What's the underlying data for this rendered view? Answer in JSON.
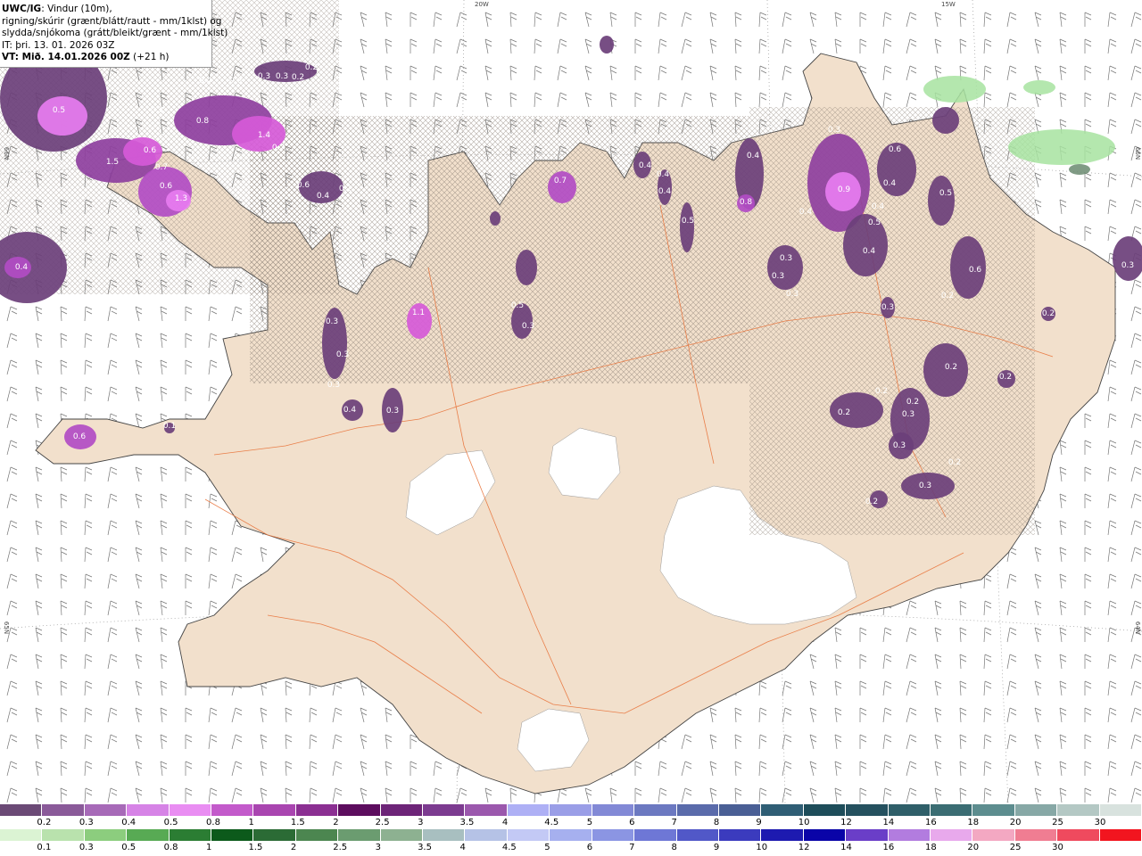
{
  "header": {
    "title_model": "UWC/IG",
    "title_rest": ": Vindur (10m),",
    "line2": "rigning/skúrir (grænt/blátt/rautt - mm/1klst) og",
    "line3": "slydda/snjókoma (grátt/bleikt/grænt - mm/1klst)",
    "init_time": "IT: þri. 13. 01. 2026 03Z",
    "valid_time_bold": "VT: Mið. 14.01.2026 00Z",
    "valid_time_rest": " (+21 h)"
  },
  "coordinate_labels": [
    "20W",
    "15W",
    "66N",
    "66N",
    "65N",
    "64N"
  ],
  "map": {
    "land_color": "#f2e0cc",
    "glacier_color": "#ffffff",
    "sea_color": "#ffffff",
    "road_color": "#e8733a",
    "snow_colors": [
      "#6b3f7a",
      "#8e3f9e",
      "#b24cc4",
      "#d65ad8",
      "#e77cf0"
    ],
    "rain_color": "#a7e3a0",
    "precip_labels": [
      "0.5",
      "1.5",
      "0.6",
      "0.7",
      "0.6",
      "1.3",
      "0.4",
      "0.6",
      "0.3",
      "0.3",
      "0.2",
      "0.2",
      "0.4",
      "0.3",
      "0.8",
      "1.4",
      "0.7",
      "0.6",
      "0.4",
      "0.2",
      "0.7",
      "0.4",
      "0.4",
      "0.4",
      "0.5",
      "0.8",
      "0.4",
      "0.3",
      "0.6",
      "0.9",
      "0.4",
      "0.4",
      "0.5",
      "0.4",
      "0.4",
      "0.5",
      "0.3",
      "0.3",
      "0.3",
      "0.6",
      "0.2",
      "0.2",
      "0.3",
      "1.1",
      "0.5",
      "0.3",
      "0.3",
      "0.3",
      "0.3",
      "0.4",
      "0.3",
      "0.1",
      "0.6",
      "0.2",
      "0.2",
      "0.2",
      "0.3",
      "0.2",
      "0.2",
      "0.2",
      "0.3",
      "0.3",
      "0.2",
      "0.3"
    ]
  },
  "legend_snow": {
    "colors": [
      "#6b4a76",
      "#8a5a99",
      "#a76ab8",
      "#d683e6",
      "#e98df2",
      "#c35acb",
      "#a945b0",
      "#8b2f92",
      "#5c0d5e",
      "#6d2478",
      "#7c3b90",
      "#9b58ad",
      "#aeb0f5",
      "#9a9ee7",
      "#8289d6",
      "#6c79c1",
      "#5a6bab",
      "#4a5f95",
      "#2f5e75",
      "#1e4d5a",
      "#25515f",
      "#2f5f69",
      "#3b6d73",
      "#5d8d8f",
      "#87a8a6",
      "#b4c8c4",
      "#d8e2de"
    ],
    "labels": [
      "0.2",
      "0.3",
      "0.4",
      "0.5",
      "0.8",
      "1",
      "1.5",
      "2",
      "2.5",
      "3",
      "3.5",
      "4",
      "4.5",
      "5",
      "6",
      "7",
      "8",
      "9",
      "10",
      "12",
      "14",
      "16",
      "18",
      "20",
      "25",
      "30"
    ]
  },
  "legend_rain": {
    "colors": [
      "#dbf3d3",
      "#b9e2ad",
      "#8ccd7e",
      "#58aa54",
      "#2b7d33",
      "#0c5a1b",
      "#2b6b35",
      "#4c8650",
      "#6b9c70",
      "#8db191",
      "#a8bfc0",
      "#b5c2e6",
      "#c3c9f5",
      "#a6b0ef",
      "#8b95e3",
      "#6e77d6",
      "#5158c8",
      "#3b3bbe",
      "#1d1ab0",
      "#0a04a8",
      "#6a3ec8",
      "#b27cdf",
      "#e8a9ec",
      "#f3a8c2",
      "#f07d92",
      "#ef4a5e",
      "#f2151f"
    ],
    "labels": [
      "0.1",
      "0.3",
      "0.5",
      "0.8",
      "1",
      "1.5",
      "2",
      "2.5",
      "3",
      "3.5",
      "4",
      "4.5",
      "5",
      "6",
      "7",
      "8",
      "9",
      "10",
      "12",
      "14",
      "16",
      "18",
      "20",
      "25",
      "30"
    ]
  }
}
